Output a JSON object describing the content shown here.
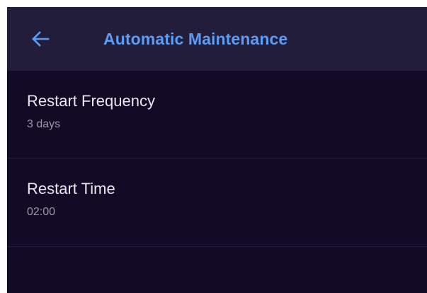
{
  "app_bar": {
    "title": "Automatic Maintenance",
    "back_icon": "arrow-back-icon",
    "title_color": "#5c9cf5",
    "background": "#221d3a"
  },
  "settings": [
    {
      "label": "Restart Frequency",
      "value": "3 days"
    },
    {
      "label": "Restart Time",
      "value": "02:00"
    }
  ],
  "colors": {
    "background": "#110b26",
    "primary_text": "#e9e8ef",
    "secondary_text": "#9a97a6",
    "divider": "#221c3f"
  }
}
